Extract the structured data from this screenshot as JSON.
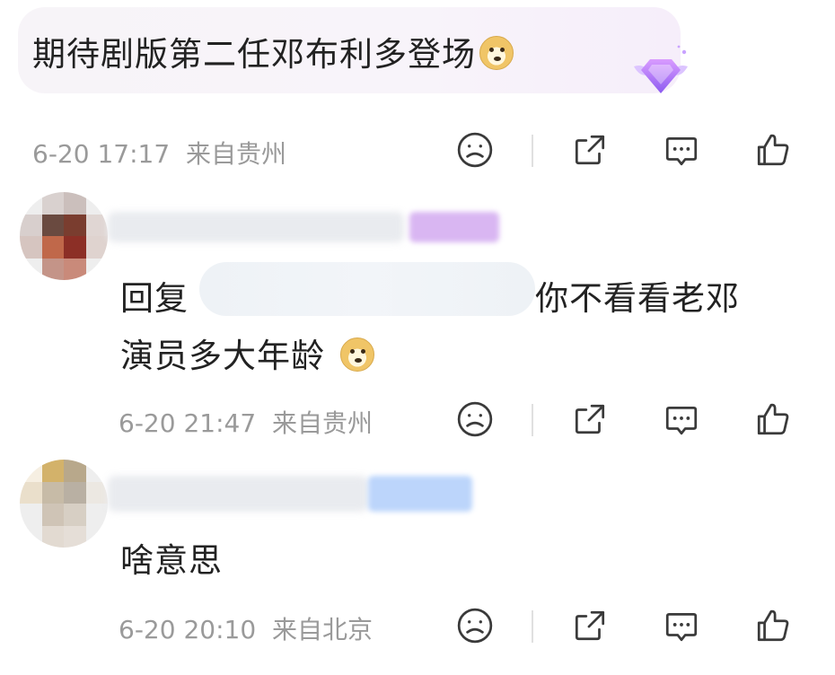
{
  "comment": {
    "text": "期待剧版第二任邓布利多登场",
    "emoji": "doge-icon",
    "date": "6-20 17:17",
    "location": "来自贵州"
  },
  "replies": [
    {
      "prefix": "回复",
      "text_line1_tail": "你不看看老邓",
      "text_line2": "演员多大年龄",
      "emoji": "doge-icon",
      "date": "6-20 21:47",
      "location": "来自贵州"
    },
    {
      "text": "啥意思",
      "date": "6-20 20:10",
      "location": "来自北京"
    }
  ],
  "colors": {
    "meta": "#9a9a9a",
    "text": "#222222",
    "icon": "#3a3a3a"
  }
}
